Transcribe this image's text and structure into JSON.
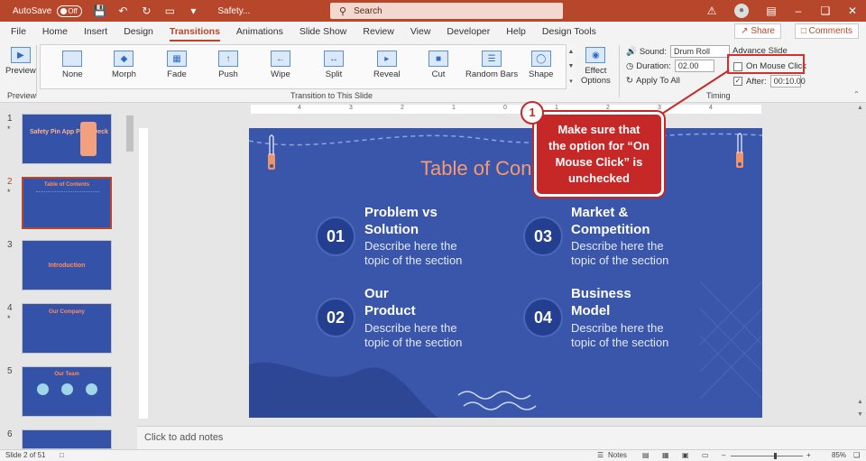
{
  "titlebar": {
    "autosave_label": "AutoSave",
    "autosave_state": "Off",
    "doc_name": "Safety...",
    "search_placeholder": "Search"
  },
  "menu": {
    "tabs": [
      "File",
      "Home",
      "Insert",
      "Design",
      "Transitions",
      "Animations",
      "Slide Show",
      "Review",
      "View",
      "Developer",
      "Help",
      "Design Tools"
    ],
    "active": "Transitions",
    "share_label": "Share",
    "comments_label": "Comments"
  },
  "ribbon": {
    "preview_label": "Preview",
    "preview_group": "Preview",
    "transitions": [
      "None",
      "Morph",
      "Fade",
      "Push",
      "Wipe",
      "Split",
      "Reveal",
      "Cut",
      "Random Bars",
      "Shape"
    ],
    "effect_options_line1": "Effect",
    "effect_options_line2": "Options",
    "transition_group": "Transition to This Slide",
    "timing": {
      "sound_label": "Sound:",
      "sound_value": "Drum Roll",
      "duration_label": "Duration:",
      "duration_value": "02.00",
      "apply_all_label": "Apply To All",
      "advance_label": "Advance Slide",
      "on_click_label": "On Mouse Click",
      "after_label": "After:",
      "after_value": "00:10.00",
      "group_label": "Timing"
    }
  },
  "thumbnails": [
    {
      "num": "1",
      "star": "*",
      "title": "Safety Pin App Pitch Deck"
    },
    {
      "num": "2",
      "star": "*",
      "title": "Table of Contents"
    },
    {
      "num": "3",
      "star": "",
      "title": "Introduction"
    },
    {
      "num": "4",
      "star": "*",
      "title": "Our Company"
    },
    {
      "num": "5",
      "star": "",
      "title": "Our Team"
    },
    {
      "num": "6",
      "star": "",
      "title": ""
    }
  ],
  "slide": {
    "title": "Table of Con",
    "items": [
      {
        "num": "01",
        "title_1": "Problem vs",
        "title_2": "Solution",
        "desc_1": "Describe here the",
        "desc_2": "topic of the section"
      },
      {
        "num": "02",
        "title_1": "Our",
        "title_2": "Product",
        "desc_1": "Describe here the",
        "desc_2": "topic of the section"
      },
      {
        "num": "03",
        "title_1": "Market &",
        "title_2": "Competition",
        "desc_1": "Describe here the",
        "desc_2": "topic of the section"
      },
      {
        "num": "04",
        "title_1": "Business",
        "title_2": "Model",
        "desc_1": "Describe here the",
        "desc_2": "topic of the section"
      }
    ]
  },
  "notes_placeholder": "Click to add notes",
  "status": {
    "slide_info": "Slide 2 of 51",
    "notes_label": "Notes",
    "zoom": "85%"
  },
  "callout": {
    "badge": "1",
    "line1": "Make sure that",
    "line2": "the option for “On",
    "line3": "Mouse Click” is",
    "line4": "unchecked"
  },
  "ruler_marks": [
    "4",
    "3",
    "2",
    "1",
    "0",
    "1",
    "2",
    "3",
    "4"
  ]
}
